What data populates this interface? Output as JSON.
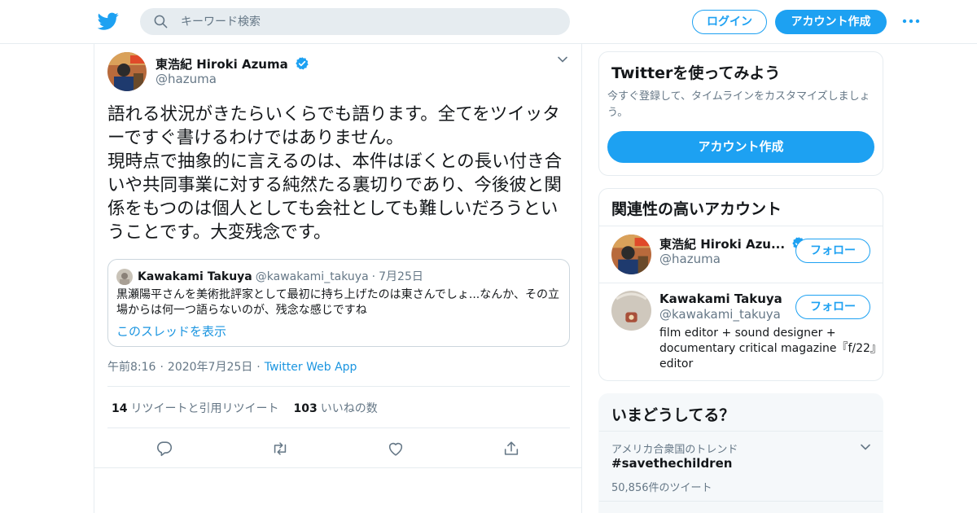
{
  "header": {
    "search_placeholder": "キーワード検索",
    "login_label": "ログイン",
    "signup_label": "アカウント作成"
  },
  "tweet": {
    "author_name": "東浩紀 Hiroki Azuma",
    "author_handle": "@hazuma",
    "text": "語れる状況がきたらいくらでも語ります。全てをツイッターですぐ書けるわけではありません。\n現時点で抽象的に言えるのは、本件はぼくとの長い付き合いや共同事業に対する純然たる裏切りであり、今後彼と関係をもつのは個人としても会社としても難しいだろうということです。大変残念です。",
    "quote": {
      "author_name": "Kawakami Takuya",
      "author_handle": "@kawakami_takuya",
      "date": "7月25日",
      "text": "黒瀬陽平さんを美術批評家として最初に持ち上げたのは東さんでしょ...なんか、その立場からは何一つ語らないのが、残念な感じですね",
      "thread_link": "このスレッドを表示"
    },
    "time": "午前8:16",
    "date": "2020年7月25日",
    "app": "Twitter Web App",
    "retweets_count": "14",
    "retweets_label": "リツイートと引用リツイート",
    "likes_count": "103",
    "likes_label": "いいねの数"
  },
  "sidebar": {
    "signup_card": {
      "title": "Twitterを使ってみよう",
      "description": "今すぐ登録して、タイムラインをカスタマイズしましょう。",
      "button_label": "アカウント作成"
    },
    "relevant": {
      "title": "関連性の高いアカウント",
      "accounts": [
        {
          "name": "東浩紀 Hiroki Azu...",
          "handle": "@hazuma",
          "verified": true,
          "bio": "",
          "follow_label": "フォロー"
        },
        {
          "name": "Kawakami Takuya",
          "handle": "@kawakami_takuya",
          "verified": false,
          "bio": "film editor + sound designer + documentary critical magazine『f/22』editor",
          "follow_label": "フォロー"
        }
      ]
    },
    "trends": {
      "title": "いまどうしてる？",
      "items": [
        {
          "context": "アメリカ合衆国のトレンド",
          "name": "#savethechildren",
          "count": "50,856件のツイート"
        }
      ]
    }
  },
  "colors": {
    "accent": "#1da1f2",
    "link": "#1b95e0",
    "text_primary": "#14171a",
    "text_secondary": "#657786",
    "border": "#e6ecf0"
  },
  "icons": [
    "twitter-bird-icon",
    "search-icon",
    "more-icon",
    "verified-icon",
    "chevron-down-icon",
    "reply-icon",
    "retweet-icon",
    "like-icon",
    "share-icon"
  ]
}
